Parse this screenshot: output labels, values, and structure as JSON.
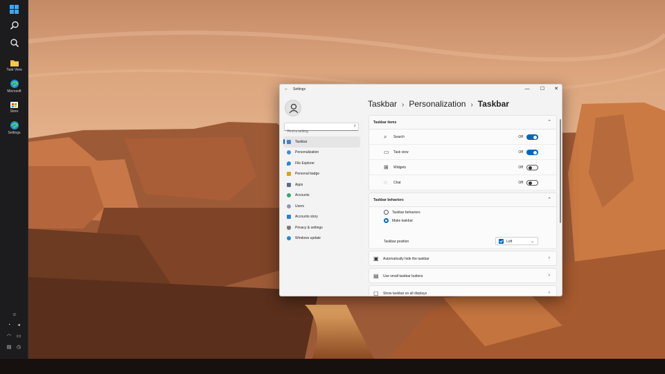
{
  "taskbar": {
    "items": [
      {
        "label": "",
        "icon": "start-windows-icon"
      },
      {
        "label": "",
        "icon": "search-icon"
      },
      {
        "label": "",
        "icon": "search-icon"
      },
      {
        "label": "Task View",
        "icon": "folder-icon"
      },
      {
        "label": "Microsoft",
        "icon": "edge-icon"
      },
      {
        "label": "Store",
        "icon": "store-icon"
      },
      {
        "label": "Settings",
        "icon": "edge-icon"
      }
    ],
    "system_icons": [
      "people-icon",
      "speaker-icon",
      "volume-icon",
      "wifi-icon",
      "battery-icon",
      "clock-icon",
      "keyboard-icon",
      "power-icon"
    ]
  },
  "window": {
    "title": "Settings",
    "back_glyph": "←",
    "controls": [
      "—",
      "☐",
      "✕"
    ]
  },
  "sidebar": {
    "search_placeholder": "Find a setting",
    "items": [
      {
        "label": "Taskbar",
        "color": "#4a7dc7",
        "active": true
      },
      {
        "label": "Personalization",
        "color": "#3b8fd9",
        "active": false
      },
      {
        "label": "File Explorer",
        "color": "#1e88e5",
        "active": false
      },
      {
        "label": "Personal badge",
        "color": "#d9a21b",
        "active": false
      },
      {
        "label": "Apps",
        "color": "#5a6b8c",
        "active": false
      },
      {
        "label": "Accounts",
        "color": "#2bab72",
        "active": false
      },
      {
        "label": "Users",
        "color": "#8a9ab0",
        "active": false
      },
      {
        "label": "Accounts story",
        "color": "#2a7fd4",
        "active": false
      },
      {
        "label": "Privacy & settings",
        "color": "#7b7b7b",
        "active": false
      },
      {
        "label": "Windows update",
        "color": "#1b8ad6",
        "active": false
      }
    ]
  },
  "breadcrumb": {
    "part1": "Taskbar",
    "part2": "Personalization",
    "current": "Taskbar",
    "sep": "›"
  },
  "taskbar_items": {
    "title": "Taskbar items",
    "rows": [
      {
        "label": "Search",
        "state": "Off",
        "on": true,
        "icon": "search-icon",
        "glyph": "⌕"
      },
      {
        "label": "Task view",
        "state": "Off",
        "on": true,
        "icon": "task-view-icon",
        "glyph": "▭"
      },
      {
        "label": "Widgets",
        "state": "Off",
        "on": false,
        "icon": "widgets-icon",
        "glyph": "⊞"
      },
      {
        "label": "Chat",
        "state": "Off",
        "on": false,
        "icon": "chat-icon",
        "glyph": "◌"
      }
    ]
  },
  "taskbar_behaviors": {
    "title": "Taskbar behaviors",
    "radio1": "Taskbar behaviors",
    "radio2": "Make taskbar",
    "position_label": "Taskbar position",
    "position_value": "Left"
  },
  "links": [
    {
      "label": "Automatically hide the taskbar",
      "icon": "hide-icon",
      "glyph": "▣"
    },
    {
      "label": "Use small taskbar buttons",
      "icon": "buttons-icon",
      "glyph": "▤"
    },
    {
      "label": "Show taskbar on all displays",
      "icon": "display-icon",
      "glyph": "▢"
    }
  ],
  "colors": {
    "accent": "#0067c0"
  }
}
